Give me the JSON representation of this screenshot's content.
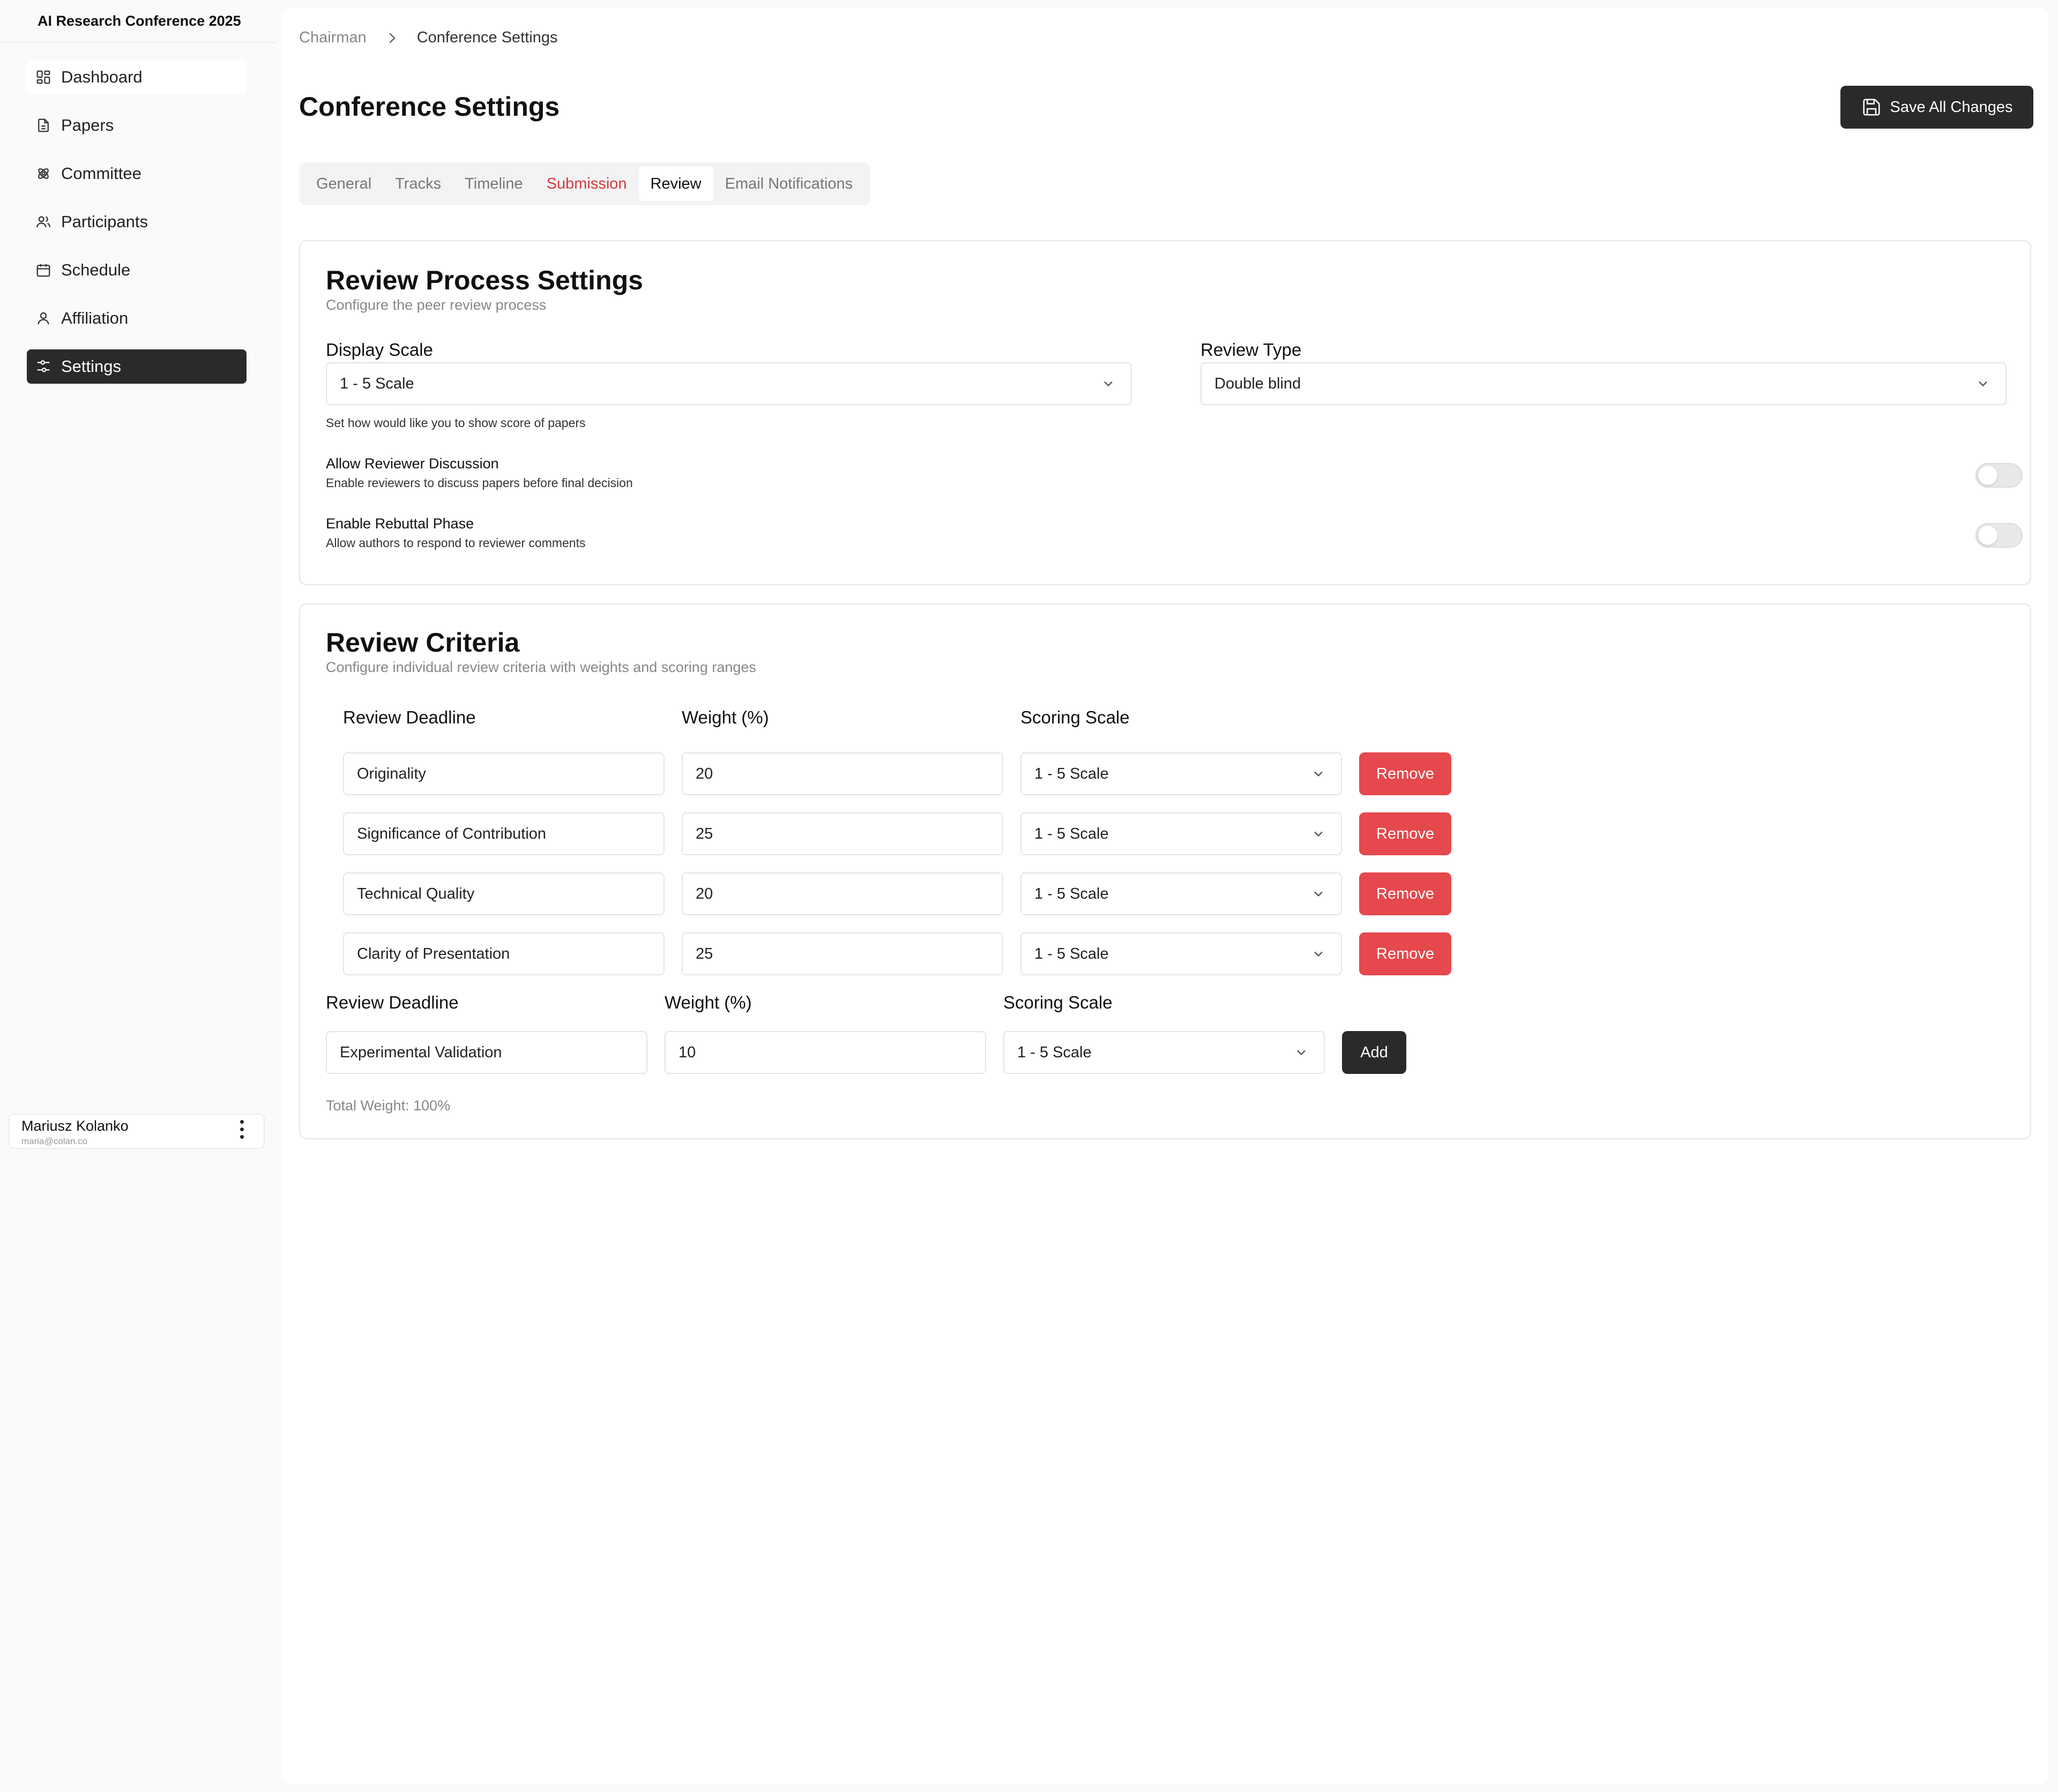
{
  "app": {
    "title": "AI Research Conference 2025"
  },
  "sidebar": {
    "items": [
      {
        "label": "Dashboard",
        "icon": "dashboard-icon"
      },
      {
        "label": "Papers",
        "icon": "file-icon"
      },
      {
        "label": "Committee",
        "icon": "committee-icon"
      },
      {
        "label": "Participants",
        "icon": "users-icon"
      },
      {
        "label": "Schedule",
        "icon": "calendar-icon"
      },
      {
        "label": "Affiliation",
        "icon": "user-icon"
      },
      {
        "label": "Settings",
        "icon": "sliders-icon",
        "active": true
      }
    ],
    "user": {
      "name": "Mariusz Kolanko",
      "email": "maria@colan.co"
    }
  },
  "breadcrumb": {
    "parent": "Chairman",
    "current": "Conference Settings"
  },
  "header": {
    "title": "Conference Settings",
    "save_label": "Save All Changes"
  },
  "tabs": [
    {
      "label": "General"
    },
    {
      "label": "Tracks"
    },
    {
      "label": "Timeline"
    },
    {
      "label": "Submission",
      "highlight": "#d33a3f"
    },
    {
      "label": "Review",
      "active": true
    },
    {
      "label": "Email Notifications"
    }
  ],
  "review_process": {
    "title": "Review Process Settings",
    "subtitle": "Configure the peer review process",
    "display_scale": {
      "label": "Display Scale",
      "value": "1 - 5 Scale",
      "hint": "Set how would like you to show score of papers"
    },
    "review_type": {
      "label": "Review Type",
      "value": "Double blind"
    },
    "discussion": {
      "title": "Allow Reviewer Discussion",
      "desc": "Enable reviewers to discuss papers before final decision",
      "enabled": false
    },
    "rebuttal": {
      "title": "Enable Rebuttal Phase",
      "desc": "Allow authors to respond to reviewer comments",
      "enabled": false
    }
  },
  "review_criteria": {
    "title": "Review Criteria",
    "subtitle": "Configure individual review criteria with weights and scoring ranges",
    "headers": {
      "name": "Review Deadline",
      "weight": "Weight (%)",
      "scale": "Scoring Scale"
    },
    "rows": [
      {
        "name": "Originality",
        "weight": "20",
        "scale": "1 - 5 Scale",
        "action": "Remove"
      },
      {
        "name": "Significance of Contribution",
        "weight": "25",
        "scale": "1 - 5 Scale",
        "action": "Remove"
      },
      {
        "name": "Technical Quality",
        "weight": "20",
        "scale": "1 - 5 Scale",
        "action": "Remove"
      },
      {
        "name": "Clarity of Presentation",
        "weight": "25",
        "scale": "1 - 5 Scale",
        "action": "Remove"
      }
    ],
    "new_row": {
      "headers": {
        "name": "Review Deadline",
        "weight": "Weight (%)",
        "scale": "Scoring Scale"
      },
      "name": "Experimental Validation",
      "weight": "10",
      "scale": "1 - 5 Scale",
      "action": "Add"
    },
    "total": "Total Weight: 100%"
  },
  "colors": {
    "accent_dark": "#2a2a2a",
    "danger": "#e5484d",
    "tab_highlight": "#d33a3f"
  }
}
